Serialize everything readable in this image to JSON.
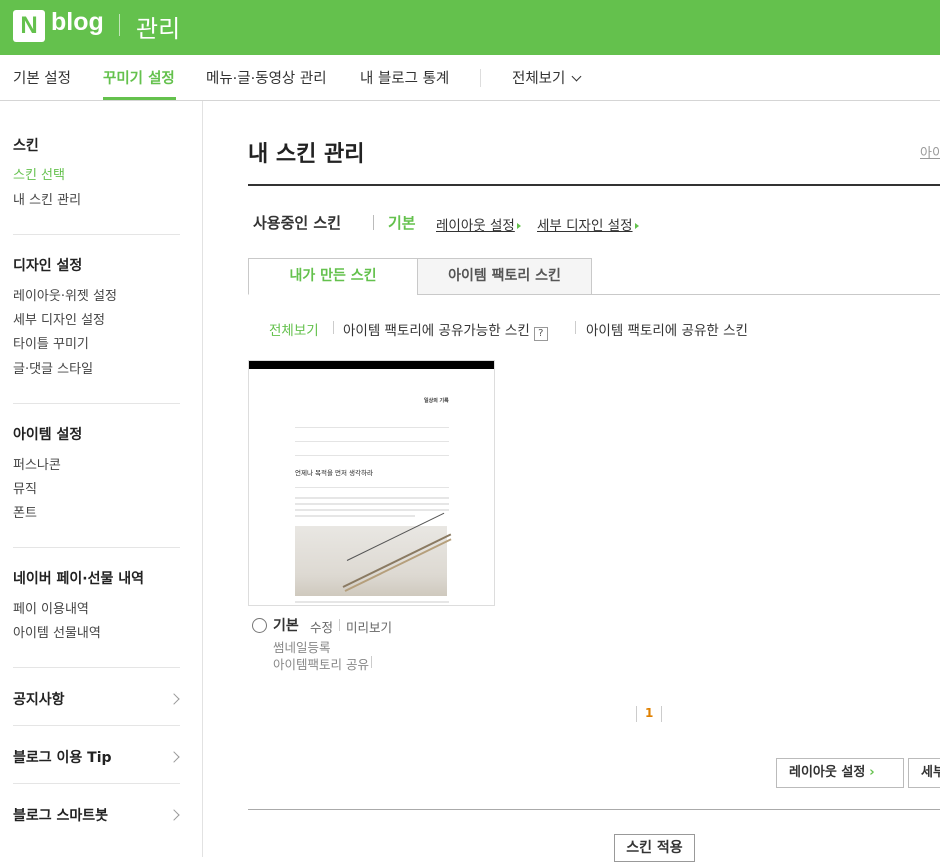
{
  "header": {
    "logo_letter": "N",
    "logo_text": "blog",
    "title": "관리"
  },
  "subnav": {
    "items": [
      "기본 설정",
      "꾸미기 설정",
      "메뉴·글·동영상 관리",
      "내 블로그 통계"
    ],
    "active_index": 1,
    "view_all": "전체보기"
  },
  "sidebar": {
    "sections": [
      {
        "title": "스킨",
        "items": [
          "스킨 선택",
          "내 스킨 관리"
        ],
        "active_item": 0
      },
      {
        "title": "디자인 설정",
        "items": [
          "레이아웃·위젯 설정",
          "세부 디자인 설정",
          "타이틀 꾸미기",
          "글·댓글 스타일"
        ]
      },
      {
        "title": "아이템 설정",
        "items": [
          "퍼스나콘",
          "뮤직",
          "폰트"
        ]
      },
      {
        "title": "네이버 페이·선물 내역",
        "items": [
          "페이 이용내역",
          "아이템 선물내역"
        ]
      }
    ],
    "links": [
      "공지사항",
      "블로그 이용 Tip",
      "블로그 스마트봇"
    ]
  },
  "main": {
    "title": "내 스킨 관리",
    "right_link": "아이",
    "in_use_label": "사용중인 스킨",
    "in_use_name": "기본",
    "layout_link": "레이아웃 설정",
    "detail_link": "세부 디자인 설정",
    "tabs": [
      "내가 만든 스킨",
      "아이템 팩토리 스킨"
    ],
    "active_tab": 0,
    "filters": [
      "전체보기",
      "아이템 팩토리에 공유가능한 스킨",
      "아이템 팩토리에 공유한 스킨"
    ],
    "help_icon_text": "?",
    "skin": {
      "name": "기본",
      "edit": "수정",
      "preview": "미리보기",
      "thumb_register": "썸네일등록",
      "factory_share": "아이템팩토리 공유",
      "preview_blog_title": "일상의 기록",
      "preview_post_title": "언제나 목적을 먼저 생각하라"
    },
    "pagination": {
      "current": "1"
    },
    "buttons": {
      "layout": "레이아웃 설정",
      "detail": "세부",
      "apply": "스킨 적용"
    }
  },
  "colors": {
    "brand_green": "#64c14d",
    "page_accent": "#e08000"
  },
  "icons": [
    "chevron-down-icon",
    "chevron-right-icon",
    "radio-icon",
    "help-icon",
    "triangle-right-icon"
  ]
}
